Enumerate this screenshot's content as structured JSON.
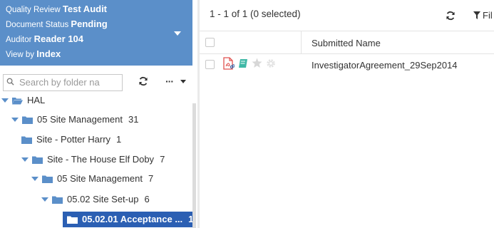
{
  "review": {
    "lines": [
      {
        "label": "Quality Review",
        "value": "Test Audit"
      },
      {
        "label": "Document Status",
        "value": "Pending"
      },
      {
        "label": "Auditor",
        "value": "Reader 104"
      },
      {
        "label": "View by",
        "value": "Index"
      }
    ]
  },
  "search": {
    "placeholder": "Search by folder na"
  },
  "tree": {
    "nodes": [
      {
        "label": "HAL",
        "count": ""
      },
      {
        "label": "05 Site Management",
        "count": "31"
      },
      {
        "label": "Site - Potter Harry",
        "count": "1"
      },
      {
        "label": "Site - The House Elf Doby",
        "count": "7"
      },
      {
        "label": "05 Site Management",
        "count": "7"
      },
      {
        "label": "05.02 Site Set-up",
        "count": "6"
      },
      {
        "label": "05.02.01 Acceptance ...",
        "count": "1"
      }
    ]
  },
  "grid": {
    "range_text": "1 - 1 of 1 (0 selected)",
    "filter_label": "Fil",
    "column_header": "Submitted Name",
    "rows": [
      {
        "name": "InvestigatorAgreement_29Sep2014"
      }
    ]
  },
  "colors": {
    "panel_blue": "#5b8fc9",
    "selected_blue": "#2b5fb3",
    "pdf_red": "#e0524f",
    "book_teal": "#3fb8a6"
  }
}
